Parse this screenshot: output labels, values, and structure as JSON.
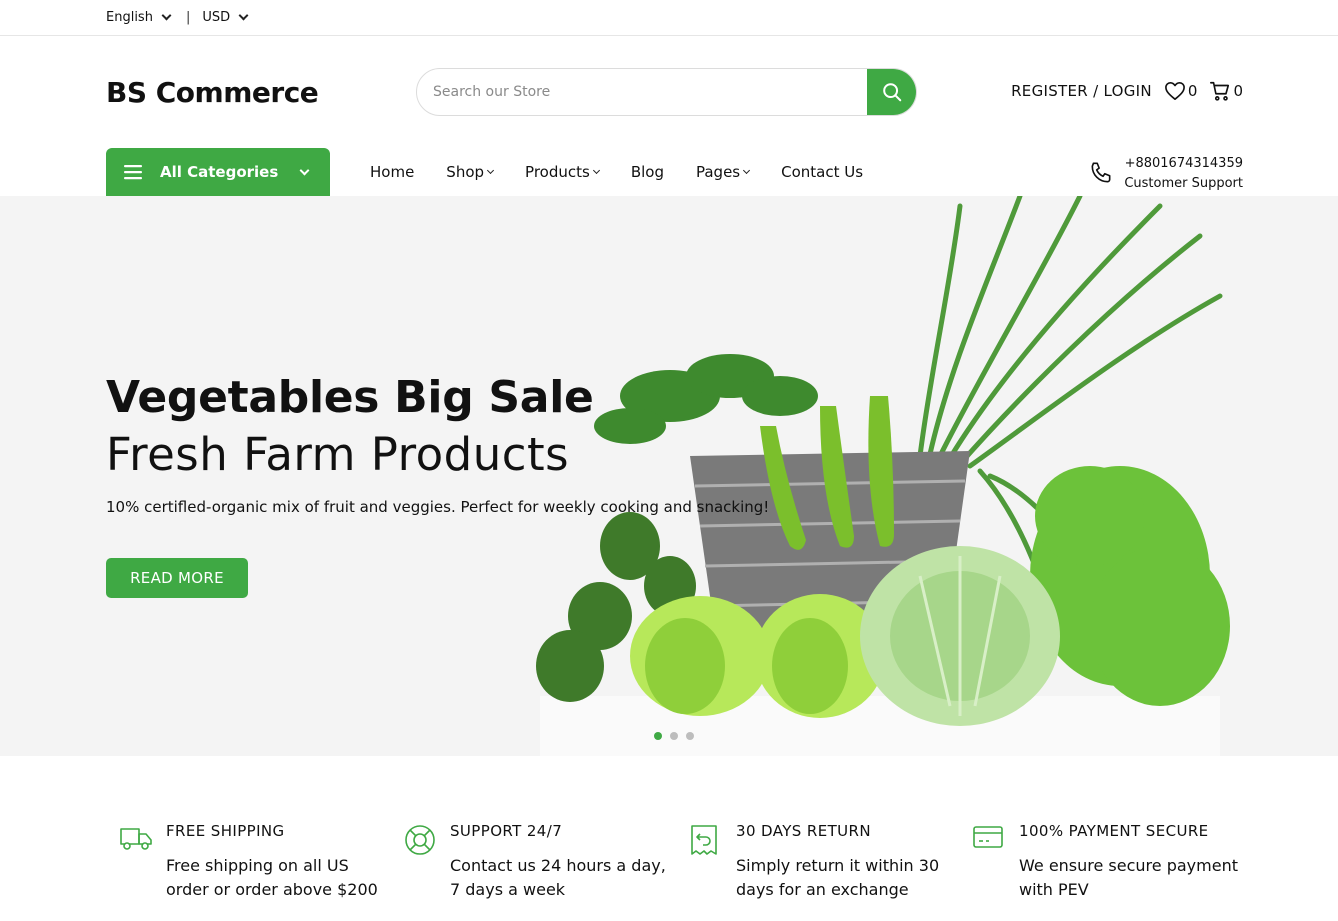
{
  "topbar": {
    "language": "English",
    "separator": "|",
    "currency": "USD"
  },
  "header": {
    "logo": "BS Commerce",
    "search_placeholder": "Search our Store",
    "account_label": "REGISTER / LOGIN",
    "wishlist_count": "0",
    "cart_count": "0"
  },
  "nav": {
    "categories_label": "All Categories",
    "items": [
      {
        "label": "Home"
      },
      {
        "label": "Shop"
      },
      {
        "label": "Products"
      },
      {
        "label": "Blog"
      },
      {
        "label": "Pages"
      },
      {
        "label": "Contact Us"
      }
    ],
    "phone": "+8801674314359",
    "support_label": "Customer Support"
  },
  "hero": {
    "title": "Vegetables Big Sale",
    "subtitle": "Fresh Farm Products",
    "description": "10% certifled-organic mix of fruit and veggies. Perfect for weekly cooking and snacking!",
    "button": "READ MORE",
    "slide_count": 3,
    "active_slide": 1
  },
  "features": [
    {
      "icon": "truck-icon",
      "title": "FREE SHIPPING",
      "desc": "Free shipping on all US order or order above $200"
    },
    {
      "icon": "lifebuoy-icon",
      "title": "SUPPORT 24/7",
      "desc": "Contact us 24 hours a day, 7 days a week"
    },
    {
      "icon": "return-icon",
      "title": "30 DAYS RETURN",
      "desc": "Simply return it within 30 days for an exchange"
    },
    {
      "icon": "credit-card-icon",
      "title": "100% PAYMENT SECURE",
      "desc": "We ensure secure payment with PEV"
    }
  ],
  "colors": {
    "accent": "#3fa944",
    "hero_bg": "#f4f4f4",
    "text": "#111111"
  }
}
